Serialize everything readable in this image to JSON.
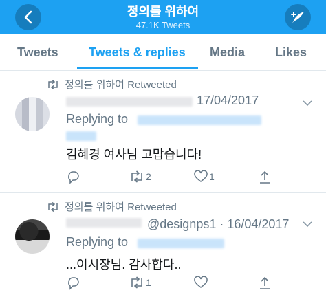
{
  "header": {
    "title": "정의를 위하여",
    "subtitle": "47.1K Tweets",
    "back_icon": "chevron-left-icon",
    "compose_icon": "compose-tweet-icon",
    "color": "#1da1f2"
  },
  "tabs": [
    {
      "label": "Tweets",
      "active": false
    },
    {
      "label": "Tweets & replies",
      "active": true
    },
    {
      "label": "Media",
      "active": false
    },
    {
      "label": "Likes",
      "active": false
    }
  ],
  "tweets": [
    {
      "retweeted_by": "정의를 위하여 Retweeted",
      "handle": "",
      "date": "17/04/2017",
      "replying_to": "Replying to",
      "text": "김혜경 여사님 고맙습니다!",
      "reply_count": "",
      "retweet_count": "2",
      "like_count": "1"
    },
    {
      "retweeted_by": "정의를 위하여 Retweeted",
      "handle_date": "@designps1 · 16/04/2017",
      "replying_to": "Replying to",
      "text": "...이시장님. 감사합다..",
      "reply_count": "",
      "retweet_count": "1",
      "like_count": ""
    }
  ],
  "colors": {
    "accent": "#1da1f2",
    "secondary_text": "#657786",
    "border": "#e1e8ed"
  }
}
